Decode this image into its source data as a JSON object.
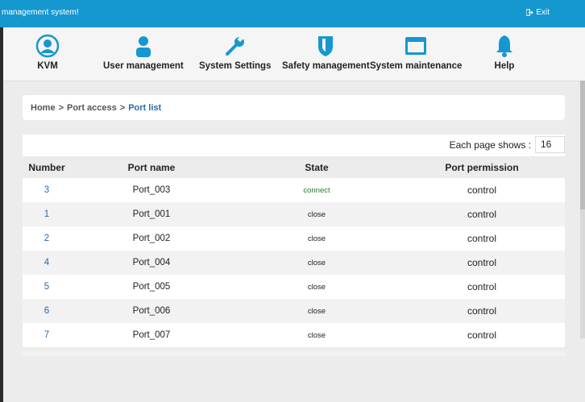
{
  "header": {
    "title": "management system!",
    "exit_label": "Exit"
  },
  "nav": {
    "items": [
      {
        "label": "KVM",
        "icon": "person-circle-icon"
      },
      {
        "label": "User management",
        "icon": "user-icon"
      },
      {
        "label": "System Settings",
        "icon": "wrench-icon"
      },
      {
        "label": "Safety management",
        "icon": "shield-icon"
      },
      {
        "label": "System maintenance",
        "icon": "monitor-icon"
      },
      {
        "label": "Help",
        "icon": "bell-icon"
      }
    ]
  },
  "breadcrumb": {
    "home": "Home",
    "sep": ">",
    "section": "Port access",
    "current": "Port list"
  },
  "pagination": {
    "label": "Each page shows :",
    "value": "16"
  },
  "table": {
    "headers": {
      "number": "Number",
      "port_name": "Port name",
      "state": "State",
      "permission": "Port permission"
    },
    "rows": [
      {
        "number": "3",
        "name": "Port_003",
        "state": "connect",
        "permission": "control"
      },
      {
        "number": "1",
        "name": "Port_001",
        "state": "close",
        "permission": "control"
      },
      {
        "number": "2",
        "name": "Port_002",
        "state": "close",
        "permission": "control"
      },
      {
        "number": "4",
        "name": "Port_004",
        "state": "close",
        "permission": "control"
      },
      {
        "number": "5",
        "name": "Port_005",
        "state": "close",
        "permission": "control"
      },
      {
        "number": "6",
        "name": "Port_006",
        "state": "close",
        "permission": "control"
      },
      {
        "number": "7",
        "name": "Port_007",
        "state": "close",
        "permission": "control"
      }
    ]
  },
  "colors": {
    "topbar": "#1597d0",
    "icon": "#1597d0",
    "link": "#2a6aa8",
    "connect": "#2c7a2c"
  }
}
